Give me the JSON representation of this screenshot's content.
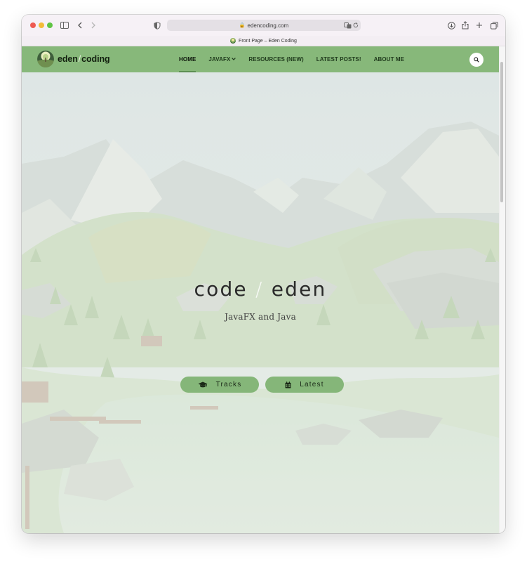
{
  "browser": {
    "url": "edencoding.com",
    "tab_title": "Front Page – Eden Coding"
  },
  "site": {
    "brand_left": "eden",
    "brand_slash": "/",
    "brand_right": "coding",
    "nav": [
      {
        "label": "HOME",
        "active": true
      },
      {
        "label": "JAVAFX",
        "active": false,
        "has_dropdown": true
      },
      {
        "label": "RESOURCES (NEW)",
        "active": false
      },
      {
        "label": "LATEST POSTS!",
        "active": false
      },
      {
        "label": "ABOUT ME",
        "active": false
      }
    ],
    "search_icon": "search-icon"
  },
  "hero": {
    "title_left": "code",
    "title_slash": "/",
    "title_right": "eden",
    "subtitle": "JavaFX and Java",
    "buttons": [
      {
        "label": "Tracks",
        "icon": "graduation-cap-icon"
      },
      {
        "label": "Latest",
        "icon": "calendar-icon"
      }
    ]
  },
  "colors": {
    "nav_green": "#87b87a",
    "button_green": "#85b679"
  }
}
